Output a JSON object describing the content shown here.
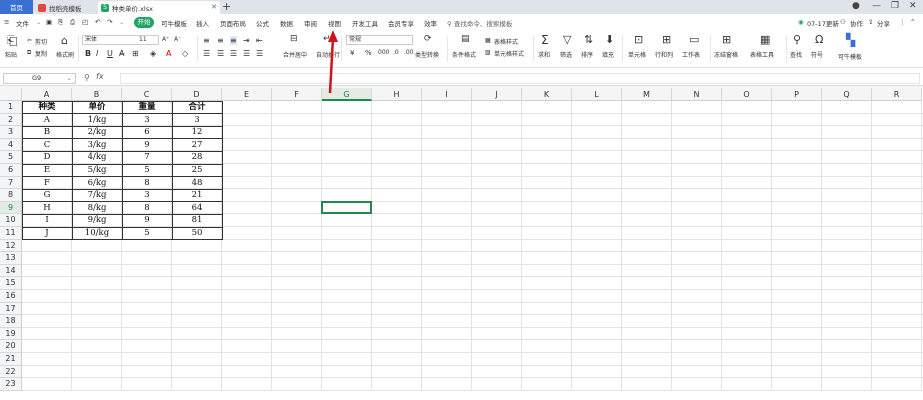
{
  "tabs": {
    "home": "首页",
    "template": "找稻壳模板",
    "file": "种类单价.xlsx"
  },
  "menu": {
    "file": "文件",
    "start": "开始",
    "items": [
      "可牛模板",
      "插入",
      "页面布局",
      "公式",
      "数据",
      "审阅",
      "视图",
      "开发工具",
      "会员专享",
      "效率"
    ],
    "search": "查找命令、搜索模板",
    "update": "07-17更新",
    "collab": "协作",
    "share": "分享"
  },
  "ribbon": {
    "paste": "粘贴",
    "cut": "剪切",
    "copy": "复制",
    "format_painter": "格式刷",
    "font": "宋体",
    "font_size": "11",
    "num_format": "常规",
    "merge": "合并居中",
    "wrap": "自动换行",
    "type_convert": "类型转换",
    "cond_format": "条件格式",
    "table_style": "表格样式",
    "cell_style": "单元格样式",
    "sum": "求和",
    "filter": "筛选",
    "sort": "排序",
    "fill": "填充",
    "cell": "单元格",
    "rowcol": "行和列",
    "sheet": "工作表",
    "freeze": "冻结窗格",
    "table_tools": "表格工具",
    "find": "查找",
    "symbol": "符号",
    "knm_template": "可牛模板"
  },
  "namebox": "G9",
  "fx": "fx",
  "columns": [
    "A",
    "B",
    "C",
    "D",
    "E",
    "F",
    "G",
    "H",
    "I",
    "J",
    "K",
    "L",
    "M",
    "N",
    "O",
    "P",
    "Q",
    "R"
  ],
  "rows": [
    "1",
    "2",
    "3",
    "4",
    "5",
    "6",
    "7",
    "8",
    "9",
    "10",
    "11",
    "12",
    "13",
    "14",
    "15",
    "16",
    "17",
    "18",
    "19",
    "20",
    "21",
    "22",
    "23"
  ],
  "selected_column": "G",
  "selected_row": "9",
  "table": {
    "headers": [
      "种类",
      "单价",
      "重量",
      "合计"
    ],
    "rows": [
      [
        "A",
        "1/kg",
        "3",
        "3"
      ],
      [
        "B",
        "2/kg",
        "6",
        "12"
      ],
      [
        "C",
        "3/kg",
        "9",
        "27"
      ],
      [
        "D",
        "4/kg",
        "7",
        "28"
      ],
      [
        "E",
        "5/kg",
        "5",
        "25"
      ],
      [
        "F",
        "6/kg",
        "8",
        "48"
      ],
      [
        "G",
        "7/kg",
        "3",
        "21"
      ],
      [
        "H",
        "8/kg",
        "8",
        "64"
      ],
      [
        "I",
        "9/kg",
        "9",
        "81"
      ],
      [
        "J",
        "10/kg",
        "5",
        "50"
      ]
    ]
  },
  "colors": {
    "accent": "#1fa463",
    "home_tab": "#3b6fd4",
    "arrow": "#d0141e",
    "selection": "#1e8a4c"
  }
}
